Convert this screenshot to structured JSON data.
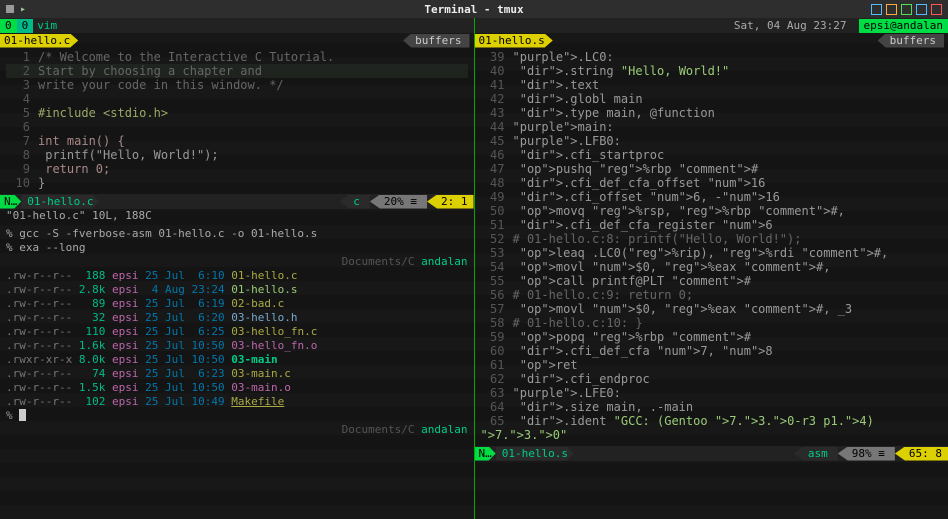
{
  "titlebar": {
    "title": "Terminal - tmux"
  },
  "top": {
    "left_idx": "0",
    "left_idx2": "0",
    "vim": "vim",
    "datetime": "Sat, 04 Aug 23:27",
    "host": "epsi@andalan"
  },
  "left": {
    "buftab": {
      "file": "01-hello.c",
      "label": "buffers"
    },
    "code": [
      {
        "n": "1",
        "t": "/* Welcome to the Interactive C Tutorial.",
        "cls": "comment"
      },
      {
        "n": "2",
        "t": "Start by choosing a chapter and",
        "cls": "comment"
      },
      {
        "n": "3",
        "t": "write your code in this window. */",
        "cls": "comment"
      },
      {
        "n": "4",
        "t": ""
      },
      {
        "n": "5",
        "t": "#include <stdio.h>",
        "cls": "include"
      },
      {
        "n": "6",
        "t": ""
      },
      {
        "n": "7",
        "t": "int main() {",
        "cls": "kw"
      },
      {
        "n": "8",
        "t": "    printf(\"Hello, World!\");",
        "cls": ""
      },
      {
        "n": "9",
        "t": "    return 0;",
        "cls": "kw"
      },
      {
        "n": "10",
        "t": "}",
        "cls": ""
      }
    ],
    "status": {
      "mode": "N…",
      "file": "01-hello.c",
      "ft": "c",
      "pct": "20% ≡",
      "pos": "2:  1"
    },
    "msg": "\"01-hello.c\" 10L, 188C",
    "cmd1": "% gcc -S -fverbose-asm 01-hello.c -o 01-hello.s",
    "cmd2": "% exa --long",
    "exahead": {
      "path": "Documents/C",
      "user": "andalan"
    },
    "files": [
      {
        "perm": ".rw-r--r--",
        "size": " 188",
        "user": "epsi",
        "date": "25 Jul",
        "time": " 6:10",
        "name": "01-hello.c",
        "cls": "fn-c"
      },
      {
        "perm": ".rw-r--r--",
        "size": "2.8k",
        "user": "epsi",
        "date": " 4 Aug",
        "time": "23:24",
        "name": "01-hello.s",
        "cls": "fn-s"
      },
      {
        "perm": ".rw-r--r--",
        "size": "  89",
        "user": "epsi",
        "date": "25 Jul",
        "time": " 6:19",
        "name": "02-bad.c",
        "cls": "fn-c"
      },
      {
        "perm": ".rw-r--r--",
        "size": "  32",
        "user": "epsi",
        "date": "25 Jul",
        "time": " 6:20",
        "name": "03-hello.h",
        "cls": "fn-h"
      },
      {
        "perm": ".rw-r--r--",
        "size": " 110",
        "user": "epsi",
        "date": "25 Jul",
        "time": " 6:25",
        "name": "03-hello_fn.c",
        "cls": "fn-c"
      },
      {
        "perm": ".rw-r--r--",
        "size": "1.6k",
        "user": "epsi",
        "date": "25 Jul",
        "time": "10:50",
        "name": "03-hello_fn.o",
        "cls": "fn-o"
      },
      {
        "perm": ".rwxr-xr-x",
        "size": "8.0k",
        "user": "epsi",
        "date": "25 Jul",
        "time": "10:50",
        "name": "03-main",
        "cls": "fn-x"
      },
      {
        "perm": ".rw-r--r--",
        "size": "  74",
        "user": "epsi",
        "date": "25 Jul",
        "time": " 6:23",
        "name": "03-main.c",
        "cls": "fn-c"
      },
      {
        "perm": ".rw-r--r--",
        "size": "1.5k",
        "user": "epsi",
        "date": "25 Jul",
        "time": "10:50",
        "name": "03-main.o",
        "cls": "fn-o"
      },
      {
        "perm": ".rw-r--r--",
        "size": " 102",
        "user": "epsi",
        "date": "25 Jul",
        "time": "10:49",
        "name": "Makefile",
        "cls": "fn-mk"
      }
    ],
    "prompt": "%",
    "exatail": {
      "path": "Documents/C",
      "user": "andalan"
    }
  },
  "right": {
    "buftab": {
      "file": "01-hello.s",
      "label": "buffers"
    },
    "code_raw": [
      "39 .LC0:",
      "40         .string \"Hello, World!\"",
      "41         .text",
      "42         .globl  main",
      "43         .type   main, @function",
      "44 main:",
      "45 .LFB0:",
      "46         .cfi_startproc",
      "47         pushq   %rbp    #",
      "48         .cfi_def_cfa_offset 16",
      "49         .cfi_offset 6, -16",
      "50         movq    %rsp, %rbp      #,",
      "51         .cfi_def_cfa_register 6",
      "52 # 01-hello.c:8:         printf(\"Hello, World!\");",
      "53         leaq    .LC0(%rip), %rdi        #,",
      "54         movl    $0, %eax        #,",
      "55         call    printf@PLT      #",
      "56 # 01-hello.c:9:         return 0;",
      "57         movl    $0, %eax        #, _3",
      "58 # 01-hello.c:10: }",
      "59         popq    %rbp    #",
      "60         .cfi_def_cfa 7, 8",
      "61         ret",
      "62         .cfi_endproc",
      "63 .LFE0:",
      "64         .size   main, .-main",
      "65         .ident  \"GCC: (Gentoo 7.3.0-r3 p1.4) 7.3.0\""
    ],
    "status": {
      "mode": "N…",
      "file": "01-hello.s",
      "ft": "asm",
      "pct": "98% ≡",
      "pos": "65:  8"
    }
  }
}
